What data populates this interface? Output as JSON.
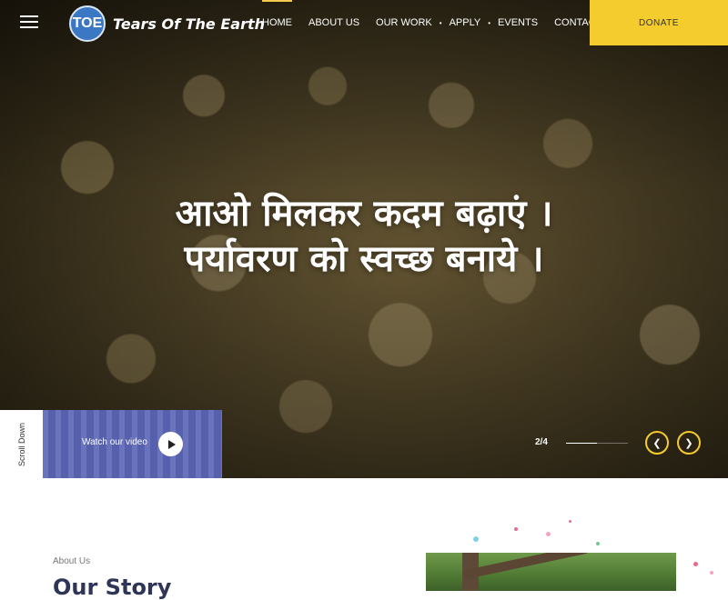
{
  "header": {
    "logo_badge": "TOE",
    "logo_text": "Tears Of The Earth",
    "nav": [
      {
        "label": "HOME"
      },
      {
        "label": "ABOUT US"
      },
      {
        "label": "OUR WORK"
      },
      {
        "label": "APPLY"
      },
      {
        "label": "EVENTS"
      },
      {
        "label": "CONTACT US"
      }
    ],
    "donate_label": "DONATE"
  },
  "hero": {
    "headline_line1": "आओ मिलकर कदम बढ़ाएं ।",
    "headline_line2": "पर्यावरण को स्वच्छ बनाये ।",
    "scroll_label": "Scroll Down",
    "video_label": "Watch our video",
    "slide_counter": "2/4",
    "slide_progress": 0.5
  },
  "about": {
    "eyebrow": "About Us",
    "title": "Our Story"
  },
  "colors": {
    "accent": "#f4cc2e",
    "nav_active": "#f2c94c",
    "video_panel": "#5a64b0",
    "title": "#2f3557"
  },
  "icons": {
    "menu": "hamburger-icon",
    "play": "play-icon",
    "prev": "chevron-left-icon",
    "next": "chevron-right-icon"
  }
}
